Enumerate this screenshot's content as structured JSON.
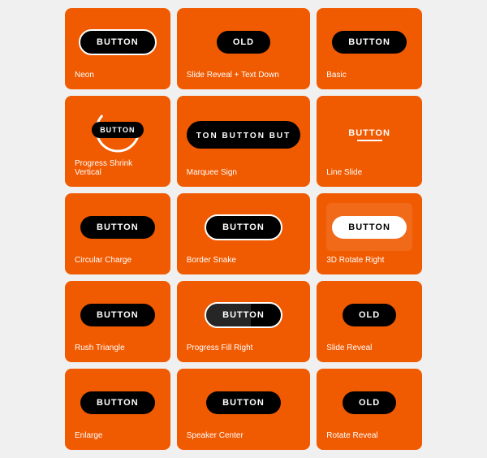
{
  "cards": [
    {
      "id": "neon",
      "label": "Neon",
      "type": "neon"
    },
    {
      "id": "slide-reveal-text-down",
      "label": "Slide Reveal + Text Down",
      "type": "slide-reveal-text",
      "btnText": "OLD"
    },
    {
      "id": "basic",
      "label": "Basic",
      "type": "basic"
    },
    {
      "id": "progress-shrink-vertical",
      "label": "Progress Shrink Vertical",
      "type": "progress-shrink"
    },
    {
      "id": "marquee-sign",
      "label": "Marquee Sign",
      "type": "marquee",
      "marqueeText": "TON  BUTTON  BUT"
    },
    {
      "id": "line-slide",
      "label": "Line Slide",
      "type": "line-slide"
    },
    {
      "id": "circular-charge",
      "label": "Circular Charge",
      "type": "circular-charge"
    },
    {
      "id": "border-snake",
      "label": "Border Snake",
      "type": "border-snake"
    },
    {
      "id": "3d-rotate-right",
      "label": "3D Rotate Right",
      "type": "3d-rotate"
    },
    {
      "id": "rush-triangle",
      "label": "Rush Triangle",
      "type": "rush-triangle"
    },
    {
      "id": "progress-fill-right",
      "label": "Progress Fill Right",
      "type": "progress-right"
    },
    {
      "id": "slide-reveal",
      "label": "Slide Reveal",
      "type": "slide-reveal",
      "btnText": "OLD"
    },
    {
      "id": "enlarge",
      "label": "Enlarge",
      "type": "enlarge"
    },
    {
      "id": "speaker-center",
      "label": "Speaker Center",
      "type": "speaker-center"
    },
    {
      "id": "rotate-reveal",
      "label": "Rotate Reveal",
      "type": "rotate-reveal",
      "btnText": "OLD"
    }
  ],
  "buttonLabel": "BUTTON"
}
